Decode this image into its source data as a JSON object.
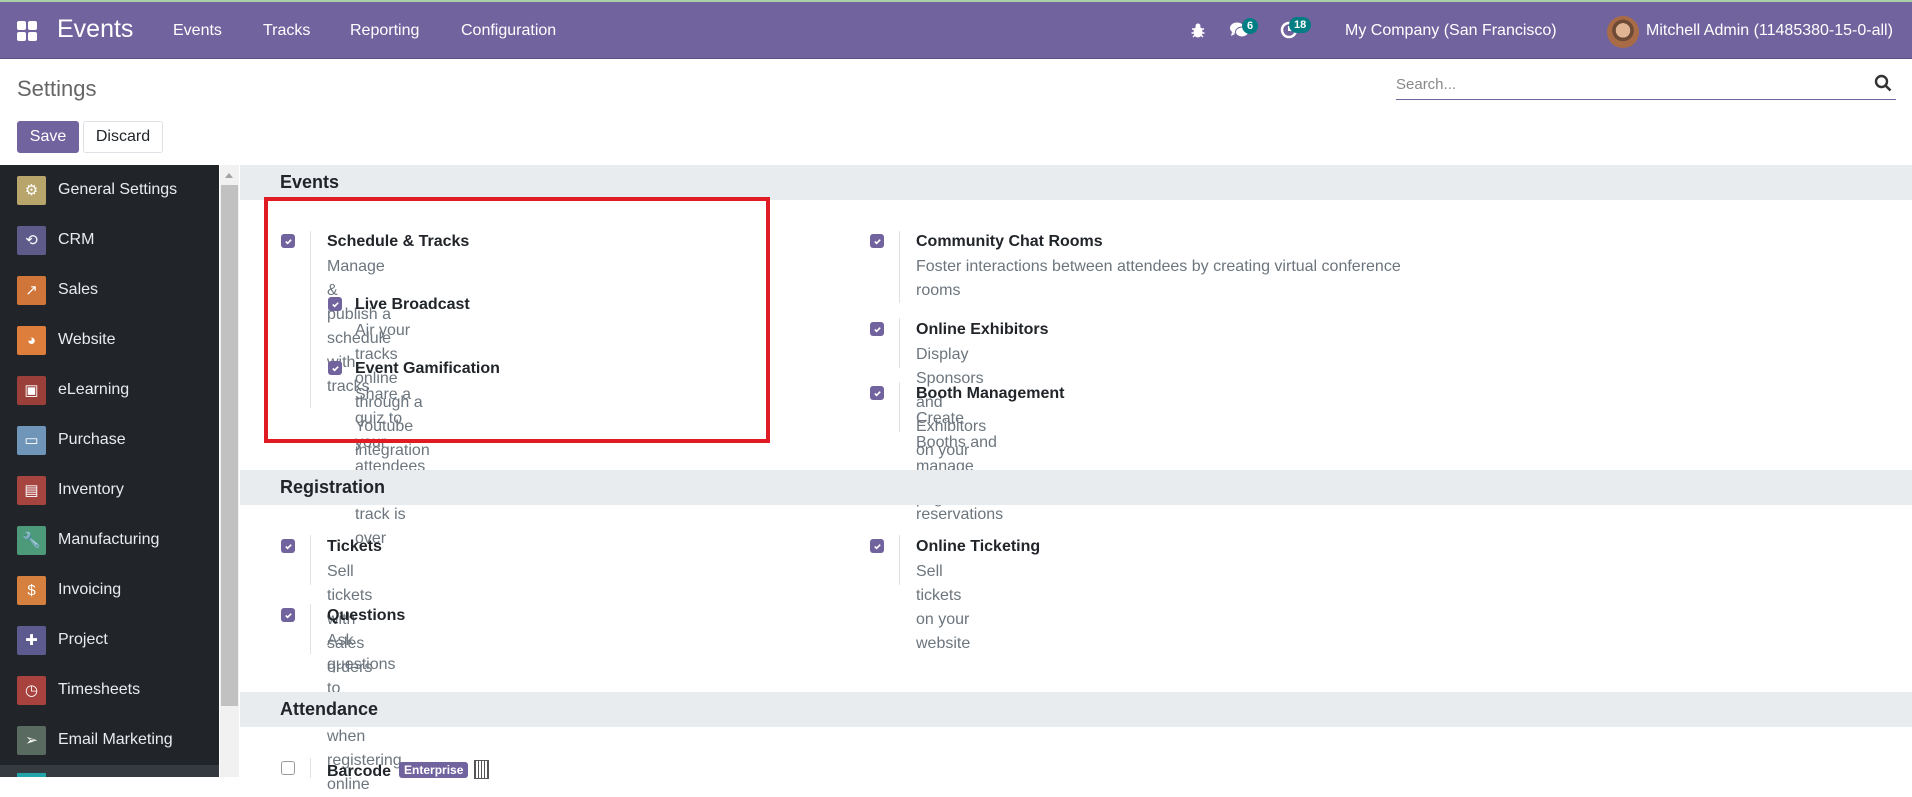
{
  "navbar": {
    "app_title": "Events",
    "menu": [
      "Events",
      "Tracks",
      "Reporting",
      "Configuration"
    ],
    "icons": {
      "apps": "apps-grid-icon",
      "debug": "bug-icon",
      "messages": "chat-icon",
      "activities": "clock-icon"
    },
    "messages_count": "6",
    "activities_count": "18",
    "company": "My Company (San Francisco)",
    "user": "Mitchell Admin (11485380-15-0-all)"
  },
  "page": {
    "title": "Settings",
    "search_placeholder": "Search...",
    "save_label": "Save",
    "discard_label": "Discard"
  },
  "sidebar": {
    "items": [
      {
        "label": "General Settings",
        "icon": "gear-icon",
        "color": "#b8a56c",
        "glyph": "⚙"
      },
      {
        "label": "CRM",
        "icon": "handshake-icon",
        "color": "#5e5a8a",
        "glyph": "⟲"
      },
      {
        "label": "Sales",
        "icon": "chart-up-icon",
        "color": "#d0763a",
        "glyph": "↗"
      },
      {
        "label": "Website",
        "icon": "globe-icon",
        "color": "#dd7e3c",
        "glyph": "◕"
      },
      {
        "label": "eLearning",
        "icon": "presentation-icon",
        "color": "#9a3f3a",
        "glyph": "▣"
      },
      {
        "label": "Purchase",
        "icon": "credit-card-icon",
        "color": "#6f95b8",
        "glyph": "▭"
      },
      {
        "label": "Inventory",
        "icon": "box-icon",
        "color": "#a64540",
        "glyph": "▤"
      },
      {
        "label": "Manufacturing",
        "icon": "wrench-icon",
        "color": "#4c9a7a",
        "glyph": "🔧"
      },
      {
        "label": "Invoicing",
        "icon": "invoice-icon",
        "color": "#d6803f",
        "glyph": "$"
      },
      {
        "label": "Project",
        "icon": "puzzle-icon",
        "color": "#5c5a8e",
        "glyph": "✚"
      },
      {
        "label": "Timesheets",
        "icon": "stopwatch-icon",
        "color": "#a8423f",
        "glyph": "◷"
      },
      {
        "label": "Email Marketing",
        "icon": "paper-plane-icon",
        "color": "#596a60",
        "glyph": "➢"
      }
    ]
  },
  "sections": {
    "events": {
      "title": "Events",
      "schedule_tracks": {
        "title": "Schedule & Tracks",
        "desc": "Manage & publish a schedule with tracks",
        "checked": true
      },
      "live_broadcast": {
        "title": "Live Broadcast",
        "desc": "Air your tracks online through a Youtube integration",
        "checked": true
      },
      "event_gamification": {
        "title": "Event Gamification",
        "desc": "Share a quiz to your attendees once a track is over",
        "checked": true
      },
      "community_chat": {
        "title": "Community Chat Rooms",
        "desc": "Foster interactions between attendees by creating virtual conference rooms",
        "checked": true
      },
      "online_exhibitors": {
        "title": "Online Exhibitors",
        "desc": "Display Sponsors and Exhibitors on your event pages",
        "checked": true
      },
      "booth_management": {
        "title": "Booth Management",
        "desc": "Create Booths and manage their reservations",
        "checked": true
      }
    },
    "registration": {
      "title": "Registration",
      "tickets": {
        "title": "Tickets",
        "desc": "Sell tickets with sales orders",
        "checked": true
      },
      "online_ticketing": {
        "title": "Online Ticketing",
        "desc": "Sell tickets on your website",
        "checked": true
      },
      "questions": {
        "title": "Questions",
        "desc": "Ask questions to attendees when registering online",
        "checked": true
      }
    },
    "attendance": {
      "title": "Attendance",
      "barcode": {
        "title": "Barcode",
        "badge": "Enterprise",
        "checked": false
      }
    }
  },
  "colors": {
    "brand": "#71639e",
    "badge": "#017e84",
    "highlight": "#e01b24"
  }
}
